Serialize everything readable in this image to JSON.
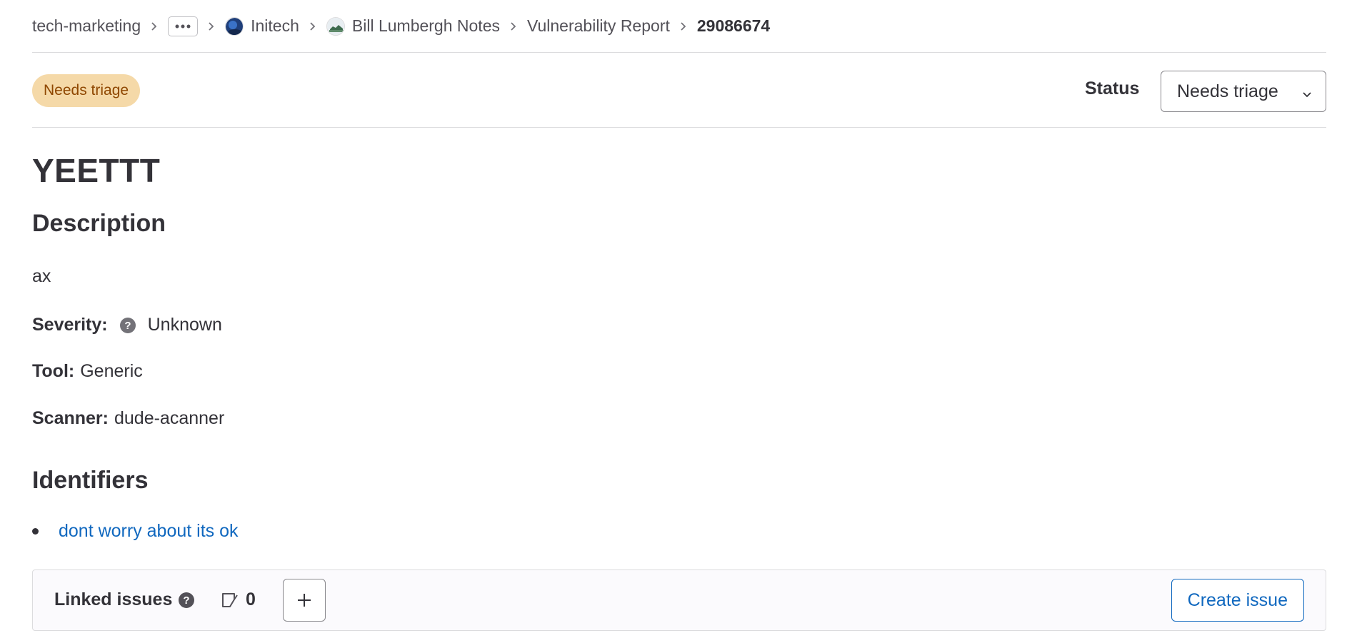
{
  "breadcrumb": {
    "items": [
      {
        "label": "tech-marketing",
        "icon": ""
      },
      {
        "label": "",
        "icon": "ellipsis-icon"
      },
      {
        "label": "Initech",
        "icon": "initech-avatar"
      },
      {
        "label": "Bill Lumbergh Notes",
        "icon": "project-avatar"
      },
      {
        "label": "Vulnerability Report",
        "icon": ""
      },
      {
        "label": "29086674",
        "icon": ""
      }
    ]
  },
  "status": {
    "badge": "Needs triage",
    "label": "Status",
    "selected": "Needs triage",
    "badge_bg": "#f5d9a8",
    "badge_fg": "#8f4700"
  },
  "vulnerability": {
    "title": "YEETTT",
    "description_heading": "Description",
    "description": "ax",
    "severity_label": "Severity:",
    "severity_value": "Unknown",
    "tool_label": "Tool:",
    "tool_value": "Generic",
    "scanner_label": "Scanner:",
    "scanner_value": "dude-acanner"
  },
  "identifiers": {
    "heading": "Identifiers",
    "items": [
      "dont worry about its ok"
    ]
  },
  "linked_issues": {
    "title": "Linked issues",
    "count": "0",
    "create_label": "Create issue"
  },
  "colors": {
    "link": "#1068bf",
    "text": "#333238",
    "border": "#dcdcde"
  }
}
